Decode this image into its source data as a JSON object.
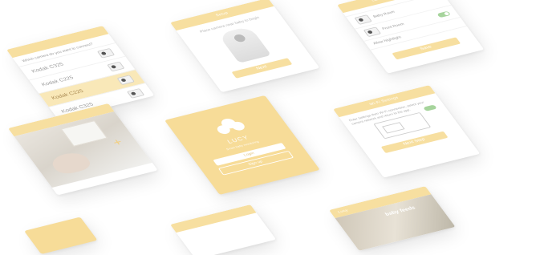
{
  "select_model": {
    "title": "",
    "question": "Which camera do you want to connect?",
    "models": [
      {
        "label": "Kodak C325",
        "selected": false
      },
      {
        "label": "Kodak C225",
        "selected": false
      },
      {
        "label": "Kodak C225",
        "selected": true
      },
      {
        "label": "Kodak C325",
        "selected": false
      }
    ]
  },
  "place_camera": {
    "title": "Setup",
    "message": "Place camera near baby to begin",
    "button": "Next"
  },
  "settings": {
    "title": "camera settings",
    "subtitle": "",
    "items": [
      "Baby Room",
      "Front Room",
      "Allow Nightlight"
    ],
    "button": "Save"
  },
  "live": {
    "title": "",
    "add_symbol": "+"
  },
  "home": {
    "brand": "LUCY",
    "tagline": "Smart baby monitoring",
    "login": "Login",
    "signup": "Sign up"
  },
  "wifi": {
    "title": "Wi-Fi Settings",
    "text": "Enter Settings then Wi-Fi connection, select your camera network and return to the app.",
    "button": "Next Step"
  },
  "bottom_right": {
    "title": "Lucy",
    "label": "baby feeds"
  },
  "bottom_center": {
    "text": ""
  }
}
